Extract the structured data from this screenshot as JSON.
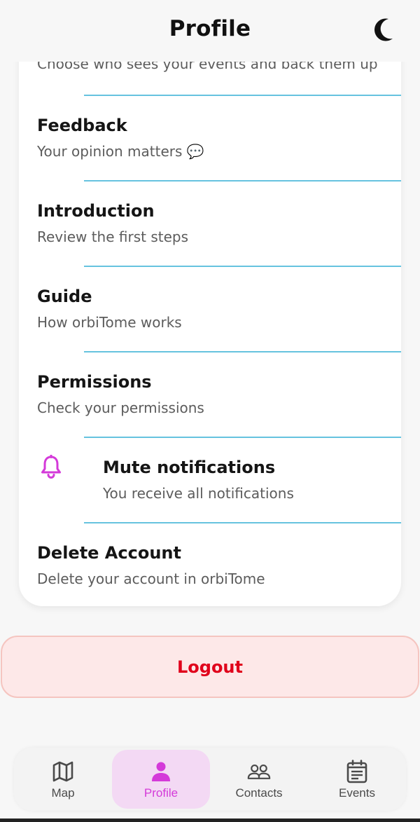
{
  "header": {
    "title": "Profile",
    "theme_icon": "moon-icon"
  },
  "settings": {
    "partial_sub": "Choose who sees your events and back them up",
    "feedback": {
      "title": "Feedback",
      "subtitle": "Your opinion matters 💬"
    },
    "introduction": {
      "title": "Introduction",
      "subtitle": "Review the first steps"
    },
    "guide": {
      "title": "Guide",
      "subtitle": "How orbiTome works"
    },
    "permissions": {
      "title": "Permissions",
      "subtitle": "Check your permissions"
    },
    "mute": {
      "title": "Mute notifications",
      "subtitle": "You receive all notifications",
      "icon": "bell-icon",
      "icon_color": "#d43ad9"
    },
    "delete": {
      "title": "Delete Account",
      "subtitle": "Delete your account in orbiTome"
    }
  },
  "logout": {
    "label": "Logout",
    "color": "#e0001b"
  },
  "nav": {
    "items": [
      {
        "label": "Map",
        "icon": "map-icon"
      },
      {
        "label": "Profile",
        "icon": "user-icon",
        "active": true
      },
      {
        "label": "Contacts",
        "icon": "contacts-icon"
      },
      {
        "label": "Events",
        "icon": "calendar-icon"
      }
    ],
    "accent": "#d43ad9"
  },
  "colors": {
    "divider": "#66c3df",
    "active_bg": "#f3d9f4"
  }
}
